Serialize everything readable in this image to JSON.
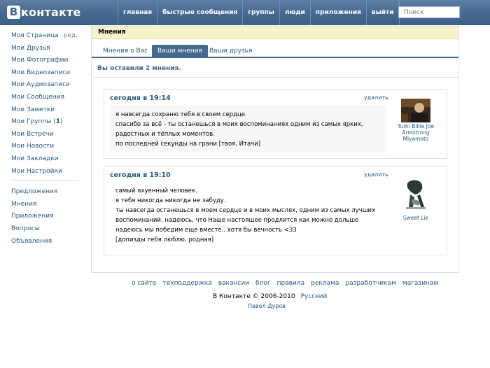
{
  "header": {
    "logo_mark": "В",
    "logo_text": "контакте",
    "nav": [
      "главная",
      "быстрые сообщения",
      "группы",
      "люди",
      "приложения",
      "выйти"
    ],
    "search_placeholder": "Поиск"
  },
  "sidebar": {
    "items": [
      {
        "label": "Моя Страница",
        "extra": "ред."
      },
      {
        "label": "Мои Друзья"
      },
      {
        "label": "Мои Фотографии"
      },
      {
        "label": "Мои Видеозаписи"
      },
      {
        "label": "Мои Аудиозаписи"
      },
      {
        "label": "Мои Сообщения"
      },
      {
        "label": "Мои Заметки"
      },
      {
        "label": "Мои Группы",
        "count": "1"
      },
      {
        "label": "Мои Встречи"
      },
      {
        "label": "Мои Новости"
      },
      {
        "label": "Мои Закладки"
      },
      {
        "label": "Мои Настройки"
      }
    ],
    "secondary": [
      "Предложения",
      "Мнения",
      "Приложения",
      "Вопросы",
      "Объявления"
    ]
  },
  "main": {
    "title": "Мнения",
    "tabs": [
      "Мнения о Вас",
      "Ваши мнения",
      "Ваши друзья"
    ],
    "active_tab": "Ваши мнения",
    "summary": "Вы оставили 2 мнения."
  },
  "opinions": [
    {
      "date": "сегодня в 19:14",
      "delete_label": "удалить",
      "lines": [
        "я навсегда сохраню тебя в своем сердце.",
        "спасибо за всё - ты останешься в моих воспоминаниях одним из самых ярких,",
        "радостных и тёплых моментов.",
        "по последней секунды на грани [твоя, Итачи]"
      ],
      "author": [
        "Yumi Billie Joe",
        "Armstrong",
        "Miyamoto"
      ]
    },
    {
      "date": "сегодня в 19:10",
      "delete_label": "удалить",
      "lines": [
        "самый ахуенный человек.",
        "я тебя никогда никогда не забуду.",
        "ты навсегда останешься в моем сердце и в моих мыслях, одним из самых лучших",
        "воспоминаний. надеюсь, что Наше настоящее продлится как можно дольше",
        "надеюсь мы победим еще вместе.. хотя бы вечность <33",
        "[допизды тебя люблю, родная]"
      ],
      "author": [
        "Sweet Lie"
      ]
    }
  ],
  "footer": {
    "links": [
      "о сайте",
      "техподдержка",
      "вакансии",
      "блог",
      "правила",
      "реклама",
      "разработчикам",
      "магазинам"
    ],
    "copyright": "В Контакте © 2006-2010",
    "language": "Русский",
    "author": "Павел Дуров"
  },
  "colors": {
    "header_blue": "#45688e",
    "link_blue": "#2b587a",
    "title_bar_yellow": "#f7f3c9"
  }
}
